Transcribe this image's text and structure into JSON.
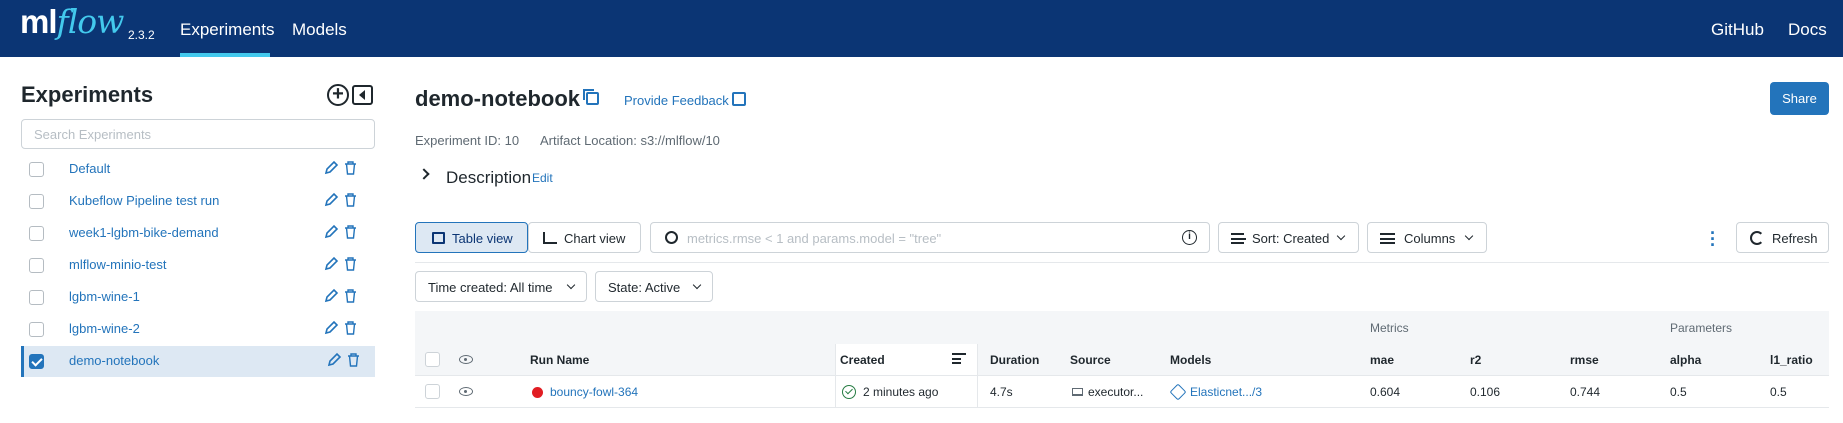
{
  "header": {
    "logo_ml": "ml",
    "logo_flow": "flow",
    "version": "2.3.2",
    "nav": [
      "Experiments",
      "Models"
    ],
    "right_links": [
      "GitHub",
      "Docs"
    ]
  },
  "sidebar": {
    "title": "Experiments",
    "search_placeholder": "Search Experiments",
    "items": [
      {
        "label": "Default",
        "checked": false
      },
      {
        "label": "Kubeflow Pipeline test run",
        "checked": false
      },
      {
        "label": "week1-lgbm-bike-demand",
        "checked": false
      },
      {
        "label": "mlflow-minio-test",
        "checked": false
      },
      {
        "label": "lgbm-wine-1",
        "checked": false
      },
      {
        "label": "lgbm-wine-2",
        "checked": false
      },
      {
        "label": "demo-notebook",
        "checked": true
      }
    ]
  },
  "main": {
    "title": "demo-notebook",
    "feedback": "Provide Feedback",
    "share": "Share",
    "experiment_id": "Experiment ID: 10",
    "artifact_location": "Artifact Location: s3://mlflow/10",
    "description": "Description",
    "description_edit": "Edit",
    "toolbar": {
      "table_view": "Table view",
      "chart_view": "Chart view",
      "search_placeholder": "metrics.rmse < 1 and params.model = \"tree\"",
      "sort": "Sort: Created",
      "columns": "Columns",
      "refresh": "Refresh"
    },
    "filters": {
      "time": "Time created: All time",
      "state": "State: Active"
    },
    "table": {
      "groups": {
        "metrics": "Metrics",
        "parameters": "Parameters"
      },
      "columns": [
        "Run Name",
        "Created",
        "Duration",
        "Source",
        "Models",
        "mae",
        "r2",
        "rmse",
        "alpha",
        "l1_ratio"
      ],
      "rows": [
        {
          "run_name": "bouncy-fowl-364",
          "created": "2 minutes ago",
          "duration": "4.7s",
          "source": "executor...",
          "models": "Elasticnet.../3",
          "mae": "0.604",
          "r2": "0.106",
          "rmse": "0.744",
          "alpha": "0.5",
          "l1_ratio": "0.5"
        }
      ]
    }
  },
  "colors": {
    "header_bg": "#0b3574",
    "accent": "#2374bb",
    "logo_flow": "#43c9ed",
    "run_status_failed": "#e11d23",
    "success": "#277c43"
  }
}
